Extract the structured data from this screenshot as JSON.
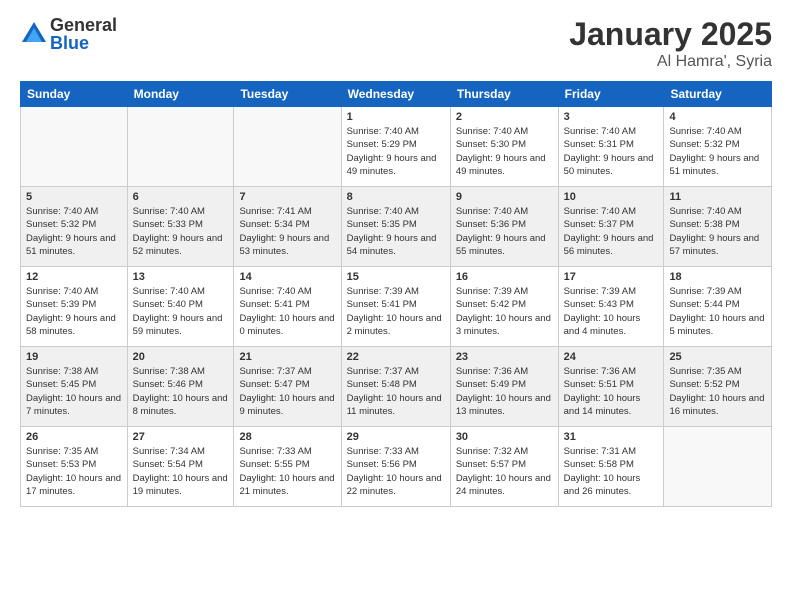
{
  "logo": {
    "general": "General",
    "blue": "Blue"
  },
  "title": {
    "month": "January 2025",
    "location": "Al Hamra', Syria"
  },
  "headers": [
    "Sunday",
    "Monday",
    "Tuesday",
    "Wednesday",
    "Thursday",
    "Friday",
    "Saturday"
  ],
  "weeks": [
    [
      {
        "day": "",
        "empty": true
      },
      {
        "day": "",
        "empty": true
      },
      {
        "day": "",
        "empty": true
      },
      {
        "day": "1",
        "sunrise": "7:40 AM",
        "sunset": "5:29 PM",
        "daylight": "9 hours and 49 minutes."
      },
      {
        "day": "2",
        "sunrise": "7:40 AM",
        "sunset": "5:30 PM",
        "daylight": "9 hours and 49 minutes."
      },
      {
        "day": "3",
        "sunrise": "7:40 AM",
        "sunset": "5:31 PM",
        "daylight": "9 hours and 50 minutes."
      },
      {
        "day": "4",
        "sunrise": "7:40 AM",
        "sunset": "5:32 PM",
        "daylight": "9 hours and 51 minutes."
      }
    ],
    [
      {
        "day": "5",
        "sunrise": "7:40 AM",
        "sunset": "5:32 PM",
        "daylight": "9 hours and 51 minutes."
      },
      {
        "day": "6",
        "sunrise": "7:40 AM",
        "sunset": "5:33 PM",
        "daylight": "9 hours and 52 minutes."
      },
      {
        "day": "7",
        "sunrise": "7:41 AM",
        "sunset": "5:34 PM",
        "daylight": "9 hours and 53 minutes."
      },
      {
        "day": "8",
        "sunrise": "7:40 AM",
        "sunset": "5:35 PM",
        "daylight": "9 hours and 54 minutes."
      },
      {
        "day": "9",
        "sunrise": "7:40 AM",
        "sunset": "5:36 PM",
        "daylight": "9 hours and 55 minutes."
      },
      {
        "day": "10",
        "sunrise": "7:40 AM",
        "sunset": "5:37 PM",
        "daylight": "9 hours and 56 minutes."
      },
      {
        "day": "11",
        "sunrise": "7:40 AM",
        "sunset": "5:38 PM",
        "daylight": "9 hours and 57 minutes."
      }
    ],
    [
      {
        "day": "12",
        "sunrise": "7:40 AM",
        "sunset": "5:39 PM",
        "daylight": "9 hours and 58 minutes."
      },
      {
        "day": "13",
        "sunrise": "7:40 AM",
        "sunset": "5:40 PM",
        "daylight": "9 hours and 59 minutes."
      },
      {
        "day": "14",
        "sunrise": "7:40 AM",
        "sunset": "5:41 PM",
        "daylight": "10 hours and 0 minutes."
      },
      {
        "day": "15",
        "sunrise": "7:39 AM",
        "sunset": "5:41 PM",
        "daylight": "10 hours and 2 minutes."
      },
      {
        "day": "16",
        "sunrise": "7:39 AM",
        "sunset": "5:42 PM",
        "daylight": "10 hours and 3 minutes."
      },
      {
        "day": "17",
        "sunrise": "7:39 AM",
        "sunset": "5:43 PM",
        "daylight": "10 hours and 4 minutes."
      },
      {
        "day": "18",
        "sunrise": "7:39 AM",
        "sunset": "5:44 PM",
        "daylight": "10 hours and 5 minutes."
      }
    ],
    [
      {
        "day": "19",
        "sunrise": "7:38 AM",
        "sunset": "5:45 PM",
        "daylight": "10 hours and 7 minutes."
      },
      {
        "day": "20",
        "sunrise": "7:38 AM",
        "sunset": "5:46 PM",
        "daylight": "10 hours and 8 minutes."
      },
      {
        "day": "21",
        "sunrise": "7:37 AM",
        "sunset": "5:47 PM",
        "daylight": "10 hours and 9 minutes."
      },
      {
        "day": "22",
        "sunrise": "7:37 AM",
        "sunset": "5:48 PM",
        "daylight": "10 hours and 11 minutes."
      },
      {
        "day": "23",
        "sunrise": "7:36 AM",
        "sunset": "5:49 PM",
        "daylight": "10 hours and 13 minutes."
      },
      {
        "day": "24",
        "sunrise": "7:36 AM",
        "sunset": "5:51 PM",
        "daylight": "10 hours and 14 minutes."
      },
      {
        "day": "25",
        "sunrise": "7:35 AM",
        "sunset": "5:52 PM",
        "daylight": "10 hours and 16 minutes."
      }
    ],
    [
      {
        "day": "26",
        "sunrise": "7:35 AM",
        "sunset": "5:53 PM",
        "daylight": "10 hours and 17 minutes."
      },
      {
        "day": "27",
        "sunrise": "7:34 AM",
        "sunset": "5:54 PM",
        "daylight": "10 hours and 19 minutes."
      },
      {
        "day": "28",
        "sunrise": "7:33 AM",
        "sunset": "5:55 PM",
        "daylight": "10 hours and 21 minutes."
      },
      {
        "day": "29",
        "sunrise": "7:33 AM",
        "sunset": "5:56 PM",
        "daylight": "10 hours and 22 minutes."
      },
      {
        "day": "30",
        "sunrise": "7:32 AM",
        "sunset": "5:57 PM",
        "daylight": "10 hours and 24 minutes."
      },
      {
        "day": "31",
        "sunrise": "7:31 AM",
        "sunset": "5:58 PM",
        "daylight": "10 hours and 26 minutes."
      },
      {
        "day": "",
        "empty": true
      }
    ]
  ]
}
